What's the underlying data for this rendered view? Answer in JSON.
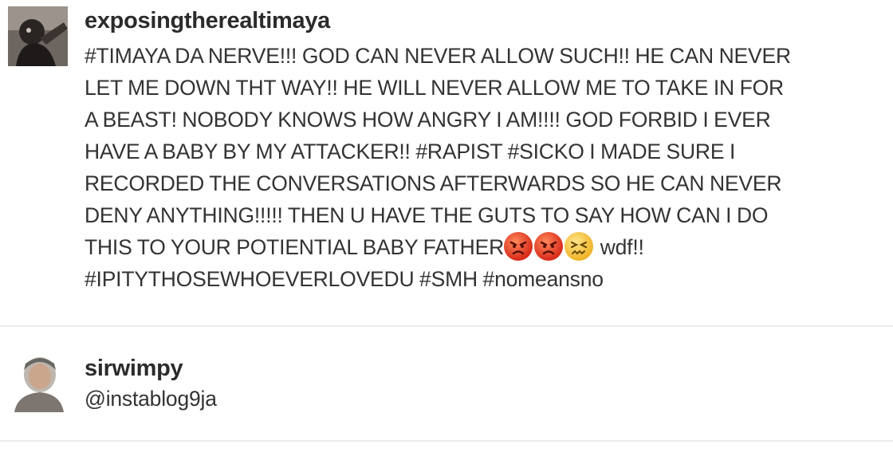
{
  "comments": [
    {
      "username": "exposingtherealtimaya",
      "avatar_icon": "user-avatar-photo",
      "lines": [
        "#TIMAYA DA NERVE!!! GOD CAN NEVER ALLOW SUCH!! HE CAN NEVER",
        "LET ME DOWN THT WAY!! HE WILL NEVER ALLOW ME TO TAKE IN FOR",
        "A BEAST! NOBODY KNOWS HOW ANGRY I AM!!!! GOD FORBID I EVER",
        "HAVE A BABY BY MY ATTACKER!! #RAPIST #SICKO I MADE SURE I",
        "RECORDED THE CONVERSATIONS AFTERWARDS SO HE CAN NEVER",
        "DENY ANYTHING!!!!! THEN U HAVE THE GUTS TO SAY HOW CAN I DO"
      ],
      "line7_text": "THIS TO YOUR POTIENTIAL BABY FATHER",
      "emojis": [
        "angry-face-icon",
        "angry-face-icon",
        "confounded-face-icon"
      ],
      "line7_suffix": "wdf!!",
      "line8": "#IPITYTHOSEWHOEVERLOVEDU #SMH #nomeansno"
    },
    {
      "username": "sirwimpy",
      "avatar_icon": "user-avatar-photo",
      "text": "@instablog9ja"
    }
  ]
}
